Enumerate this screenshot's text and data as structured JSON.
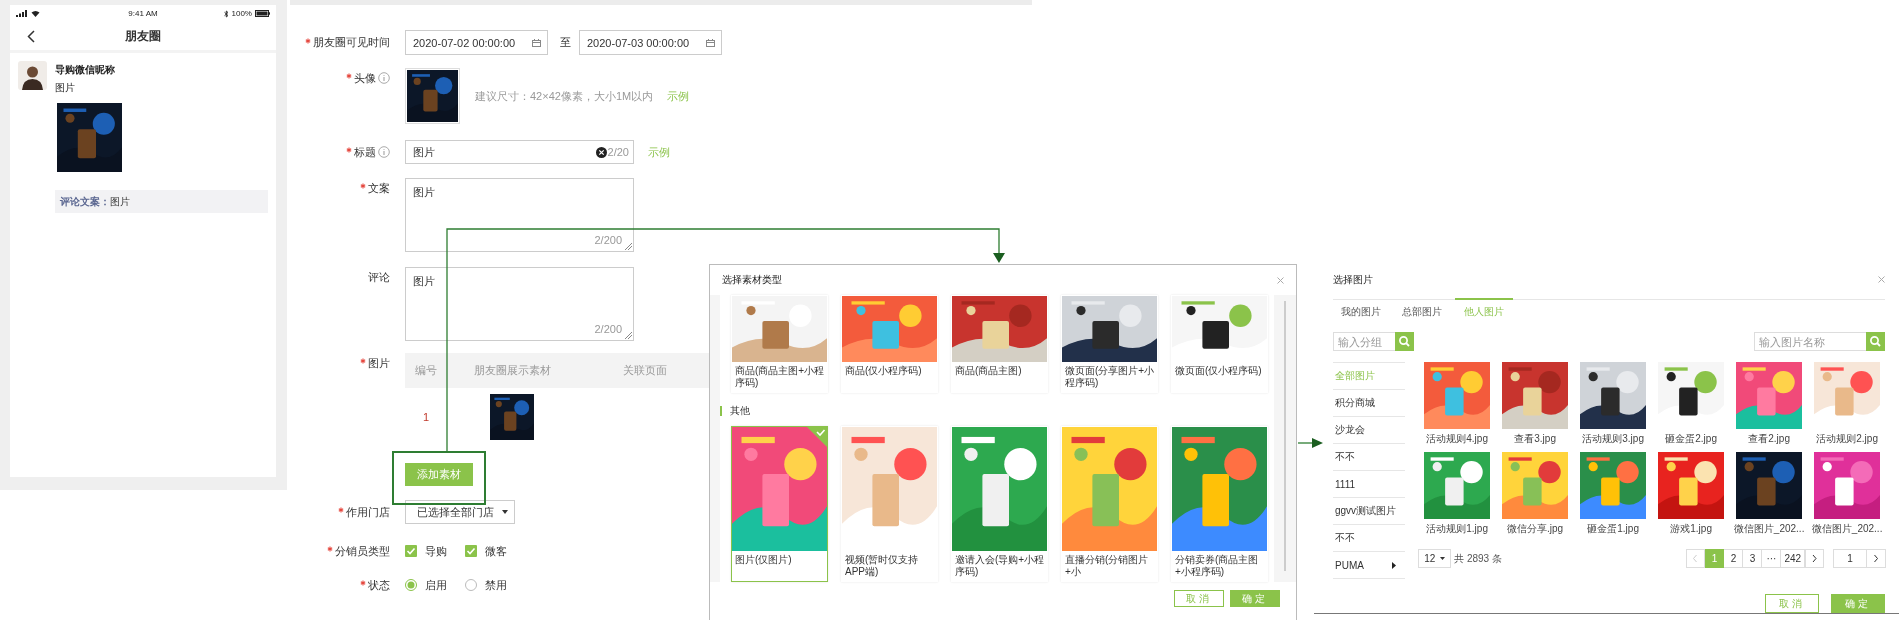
{
  "phone": {
    "status_bar": {
      "time": "9:41 AM",
      "battery": "100%"
    },
    "title": "朋友圈",
    "post": {
      "author": "导购微信昵称",
      "text": "图片",
      "comment_label": "评论文案：",
      "comment": "图片"
    }
  },
  "form": {
    "visible_time": {
      "label": "朋友圈可见时间",
      "required": true,
      "start": "2020-07-02 00:00:00",
      "separator": "至",
      "end": "2020-07-03 00:00:00"
    },
    "avatar": {
      "label": "头像",
      "required": true,
      "info": true,
      "hint": "建议尺寸：42×42像素，大小1M以内",
      "example": "示例"
    },
    "title": {
      "label": "标题",
      "required": true,
      "info": true,
      "value": "图片",
      "counter": "2/20",
      "example": "示例"
    },
    "copy": {
      "label": "文案",
      "required": true,
      "value": "图片",
      "counter": "2/200"
    },
    "comment": {
      "label": "评论",
      "required": false,
      "value": "图片",
      "counter": "2/200"
    },
    "materials": {
      "label": "图片",
      "required": true,
      "columns": [
        "编号",
        "朋友圈展示素材",
        "关联页面"
      ],
      "rows": [
        {
          "number": "1"
        }
      ],
      "add_button": "添加素材"
    },
    "store": {
      "label": "作用门店",
      "required": true,
      "value": "已选择全部门店"
    },
    "seller_type": {
      "label": "分销员类型",
      "required": true,
      "options": [
        {
          "label": "导购",
          "checked": true
        },
        {
          "label": "微客",
          "checked": true
        }
      ]
    },
    "status": {
      "label": "状态",
      "required": true,
      "options": [
        {
          "label": "启用",
          "selected": true
        },
        {
          "label": "禁用",
          "selected": false
        }
      ]
    }
  },
  "material_dialog": {
    "title": "选择素材类型",
    "groups": [
      {
        "cards": [
          {
            "label": "商品(商品主图+小程序码)",
            "selected": false
          },
          {
            "label": "商品(仅小程序码)",
            "selected": false
          },
          {
            "label": "商品(商品主图)",
            "selected": false
          },
          {
            "label": "微页面(分享图片+小程序码)",
            "selected": false
          },
          {
            "label": "微页面(仅小程序码)",
            "selected": false
          }
        ]
      },
      {
        "heading": "其他",
        "cards": [
          {
            "label": "图片(仅图片)",
            "selected": true
          },
          {
            "label": "视频(暂时仅支持APP端)",
            "selected": false
          },
          {
            "label": "邀请入会(导购+小程序码)",
            "selected": false
          },
          {
            "label": "直播分销(分销图片+小",
            "selected": false
          },
          {
            "label": "分销卖券(商品主图+小程序码)",
            "selected": false
          }
        ]
      }
    ],
    "buttons": {
      "cancel": "取消",
      "confirm": "确定"
    }
  },
  "image_dialog": {
    "title": "选择图片",
    "tabs": [
      {
        "label": "我的图片",
        "selected": false
      },
      {
        "label": "总部图片",
        "selected": false
      },
      {
        "label": "他人图片",
        "selected": true
      }
    ],
    "group_search": {
      "placeholder": "输入分组"
    },
    "name_search": {
      "placeholder": "输入图片名称"
    },
    "groups": [
      {
        "label": "全部图片",
        "selected": true,
        "expandable": false
      },
      {
        "label": "积分商城",
        "selected": false,
        "expandable": false
      },
      {
        "label": "沙龙会",
        "selected": false,
        "expandable": false
      },
      {
        "label": "不不",
        "selected": false,
        "expandable": false
      },
      {
        "label": "1111",
        "selected": false,
        "expandable": false
      },
      {
        "label": "ggvv测试图片",
        "selected": false,
        "expandable": false
      },
      {
        "label": "不不",
        "selected": false,
        "expandable": false
      },
      {
        "label": "PUMA",
        "selected": false,
        "expandable": true
      }
    ],
    "images": [
      {
        "name": "活动规则4.jpg"
      },
      {
        "name": "查看3.jpg"
      },
      {
        "name": "活动规则3.jpg"
      },
      {
        "name": "砸金蛋2.jpg"
      },
      {
        "name": "查看2.jpg"
      },
      {
        "name": "活动规则2.jpg"
      },
      {
        "name": "活动规则1.jpg"
      },
      {
        "name": "微信分享.jpg"
      },
      {
        "name": "砸金蛋1.jpg"
      },
      {
        "name": "游戏1.jpg"
      },
      {
        "name": "微信图片_202..."
      },
      {
        "name": "微信图片_202..."
      }
    ],
    "page_size": "12",
    "total": "共 2893 条",
    "pages": [
      {
        "label": "1",
        "selected": true
      },
      {
        "label": "2",
        "selected": false
      },
      {
        "label": "3",
        "selected": false
      },
      {
        "label": "···",
        "selected": false
      },
      {
        "label": "242",
        "selected": false
      }
    ],
    "jump": "1",
    "buttons": {
      "cancel": "取消",
      "confirm": "确定"
    }
  }
}
